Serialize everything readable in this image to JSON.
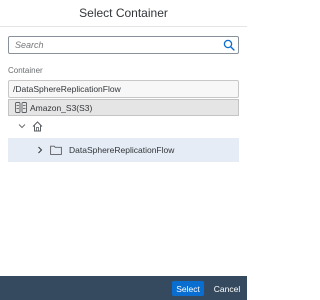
{
  "dialog": {
    "title": "Select Container"
  },
  "search": {
    "placeholder": "Search",
    "value": "",
    "icon": "search-icon"
  },
  "container": {
    "label": "Container",
    "path_value": "/DataSphereReplicationFlow"
  },
  "tree": {
    "root": {
      "label": "Amazon_S3(S3)",
      "icon": "database-icon"
    },
    "home": {
      "icon": "home-icon",
      "expander": "chevron-down-icon"
    },
    "folders": [
      {
        "label": "DataSphereReplicationFlow",
        "icon": "folder-icon",
        "expander": "chevron-right-icon",
        "selected": true
      }
    ]
  },
  "footer": {
    "select_label": "Select",
    "cancel_label": "Cancel"
  },
  "colors": {
    "footer_bg": "#354a5f",
    "accent": "#0a6ed1",
    "selected_row": "#e5ecf5",
    "root_row": "#e5e5e5"
  }
}
